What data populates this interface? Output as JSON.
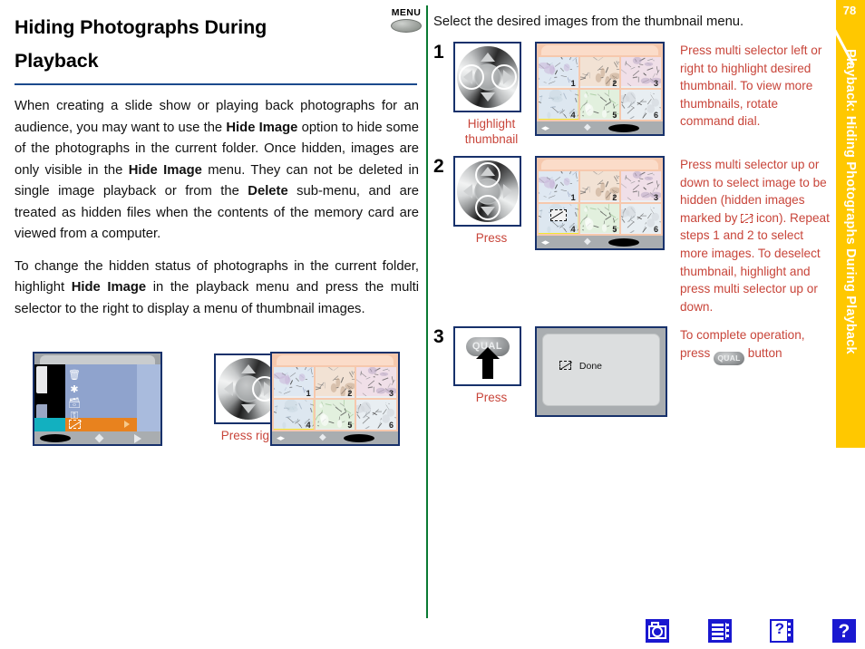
{
  "page": {
    "number": "78",
    "sidebar_title": "Playback: Hiding Photographs During Playback",
    "accent_gold": "#FFC800",
    "accent_blue": "#1B4A8C",
    "accent_red": "#C8453A",
    "divider_green": "#0A7A33"
  },
  "header": {
    "title": "Hiding Photographs During Playback",
    "menu_button_label": "MENU"
  },
  "left_column": {
    "paragraph_1_parts": [
      {
        "text": "When creating a slide show or playing back photographs for an audience, you may want to use the ",
        "bold": false
      },
      {
        "text": "Hide Image",
        "bold": true
      },
      {
        "text": " option to hide some of the photographs in the current folder.  Once hidden, images are only visible in the ",
        "bold": false
      },
      {
        "text": "Hide Image",
        "bold": true
      },
      {
        "text": " menu. They can not be deleted in single image playback or from the ",
        "bold": false
      },
      {
        "text": "Delete",
        "bold": true
      },
      {
        "text": " sub-menu, and are treated as hidden files when the contents of the memory card are viewed from a computer.",
        "bold": false
      }
    ],
    "paragraph_2_parts": [
      {
        "text": "To change the hidden status of photographs in the current folder, highlight ",
        "bold": false
      },
      {
        "text": "Hide Image",
        "bold": true
      },
      {
        "text": " in the playback menu and press the multi selector to the right to display a menu of thumbnail images.",
        "bold": false
      }
    ],
    "figures": {
      "menu_screen": {
        "name": "playback-menu-lcd",
        "icons": [
          "delete-icon",
          "slideshow-icon",
          "folder-icon",
          "protect-key-icon",
          "hide-image-icon",
          "print-set-icon"
        ],
        "highlighted_row_index": 4,
        "highlight_color": "#E8821E",
        "highlight_icon_color": "#12B0C0"
      },
      "multi_selector": {
        "name": "multi-selector-dial",
        "highlighted_directions": [
          "right"
        ],
        "caption": "Press right"
      },
      "thumbnail_screen": {
        "name": "thumbnail-menu-lcd",
        "thumbnails": [
          {
            "number": "1",
            "hidden": false,
            "selected": false
          },
          {
            "number": "2",
            "hidden": false,
            "selected": false
          },
          {
            "number": "3",
            "hidden": false,
            "selected": false
          },
          {
            "number": "4",
            "hidden": false,
            "selected": true
          },
          {
            "number": "5",
            "hidden": false,
            "selected": false
          },
          {
            "number": "6",
            "hidden": false,
            "selected": false
          }
        ]
      }
    }
  },
  "right_column": {
    "intro": "Select the desired images from the thumbnail menu.",
    "steps": [
      {
        "number": "1",
        "control_type": "multi-selector",
        "highlighted_directions": [
          "left",
          "right"
        ],
        "caption": "Highlight thumbnail",
        "screen_type": "thumbnail-grid",
        "thumbnails": [
          {
            "number": "1",
            "hidden": false,
            "selected": false
          },
          {
            "number": "2",
            "hidden": false,
            "selected": false
          },
          {
            "number": "3",
            "hidden": false,
            "selected": false
          },
          {
            "number": "4",
            "hidden": false,
            "selected": true
          },
          {
            "number": "5",
            "hidden": false,
            "selected": false
          },
          {
            "number": "6",
            "hidden": false,
            "selected": false
          }
        ],
        "text": "Press multi selector left or right to highlight desired thumbnail. To view more thumbnails, rotate command dial."
      },
      {
        "number": "2",
        "control_type": "multi-selector",
        "highlighted_directions": [
          "up",
          "down"
        ],
        "caption": "Press",
        "screen_type": "thumbnail-grid",
        "thumbnails": [
          {
            "number": "1",
            "hidden": false,
            "selected": false
          },
          {
            "number": "2",
            "hidden": false,
            "selected": false
          },
          {
            "number": "3",
            "hidden": false,
            "selected": false
          },
          {
            "number": "4",
            "hidden": true,
            "selected": true
          },
          {
            "number": "5",
            "hidden": false,
            "selected": false
          },
          {
            "number": "6",
            "hidden": false,
            "selected": false
          }
        ],
        "text_before_icon": "Press multi selector up or down to select image to be hidden (hidden images marked by ",
        "text_after_icon": " icon).  Repeat steps 1 and 2 to select more images. To deselect thumbnail, highlight and press multi selector up or down."
      },
      {
        "number": "3",
        "control_type": "qual-button",
        "button_label": "QUAL",
        "caption": "Press",
        "screen_type": "done-screen",
        "screen_text": "Done",
        "text_before_button": "To complete operation, press ",
        "button_inline_label": "QUAL",
        "text_after_button": " button"
      }
    ]
  },
  "bottom_nav": [
    {
      "name": "camera-icon",
      "label": "camera"
    },
    {
      "name": "menu-list-icon",
      "label": "menu"
    },
    {
      "name": "help-index-icon",
      "label": "help index"
    },
    {
      "name": "question-mark-icon",
      "label": "help"
    }
  ]
}
